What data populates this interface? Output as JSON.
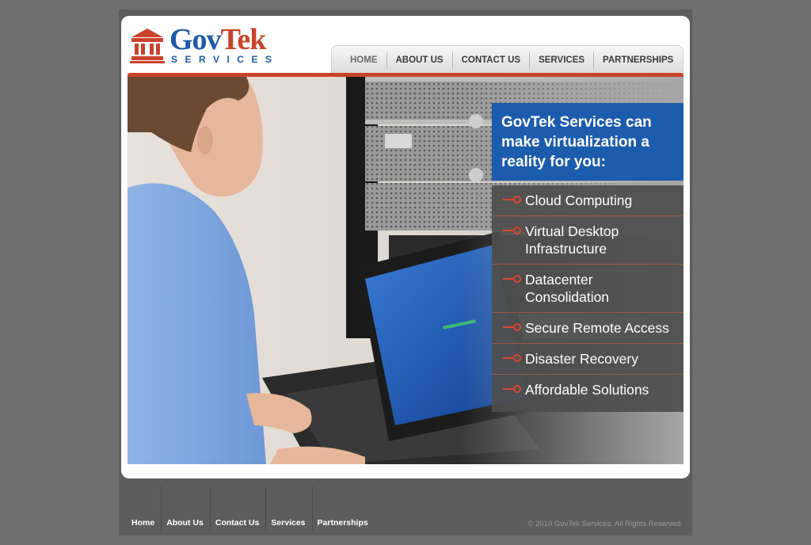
{
  "brand": {
    "name_part1": "Gov",
    "name_part2": "Tek",
    "sub": "SERVICES",
    "blue": "#1e5aa8",
    "orange": "#c9432a",
    "icon": "capitol-building-icon"
  },
  "nav": {
    "items": [
      {
        "label": "HOME",
        "active": true
      },
      {
        "label": "ABOUT US"
      },
      {
        "label": "CONTACT US"
      },
      {
        "label": "SERVICES"
      },
      {
        "label": "PARTNERSHIPS"
      }
    ]
  },
  "hero": {
    "headline": "GovTek Services can make virtualization a reality for you:",
    "services": [
      {
        "label": "Cloud Computing"
      },
      {
        "label": "Virtual Desktop Infrastructure"
      },
      {
        "label": "Datacenter Consolidation"
      },
      {
        "label": "Secure Remote Access"
      },
      {
        "label": "Disaster Recovery"
      },
      {
        "label": "Affordable Solutions"
      }
    ],
    "bullet_icon": "arrow-bullet-icon",
    "panel_blue": "#1c5cad"
  },
  "footer": {
    "links": [
      {
        "label": "Home"
      },
      {
        "label": "About Us"
      },
      {
        "label": "Contact Us"
      },
      {
        "label": "Services"
      },
      {
        "label": "Partnerships"
      }
    ],
    "copyright": "© 2010 GovTek Services. All Rights Reserved."
  }
}
